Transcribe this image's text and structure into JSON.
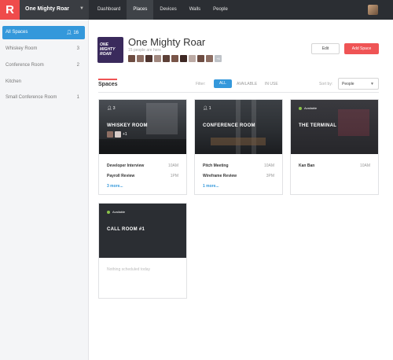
{
  "topbar": {
    "logo": "R",
    "org_name": "One Mighty Roar",
    "nav": [
      "Dashboard",
      "Places",
      "Devices",
      "Walls",
      "People"
    ],
    "active_nav": "Places"
  },
  "sidebar": {
    "items": [
      {
        "label": "All Spaces",
        "count": "16",
        "active": true
      },
      {
        "label": "Whiskey Room",
        "count": "3"
      },
      {
        "label": "Conference Room",
        "count": "2"
      },
      {
        "label": "Kitchen",
        "count": ""
      },
      {
        "label": "Small Conference Room",
        "count": "1"
      }
    ]
  },
  "place": {
    "logo_text": "ONE MIGHTY ROAR",
    "title": "One Mighty Roar",
    "subtitle": "15 people are here",
    "more_people": "+6",
    "edit_label": "Edit",
    "add_label": "Add Space"
  },
  "spaces": {
    "heading": "Spaces",
    "filter_label": "Filter:",
    "filters": [
      "ALL",
      "AVAILABLE",
      "IN USE"
    ],
    "sort_label": "Sort by:",
    "sort_value": "People"
  },
  "cards": [
    {
      "name": "WHISKEY ROOM",
      "occupancy": "3",
      "extra": "+1",
      "events": [
        {
          "title": "Developer Interview",
          "time": "10AM"
        },
        {
          "title": "Payroll Review",
          "time": "1PM"
        }
      ],
      "more": "3 more..."
    },
    {
      "name": "CONFERENCE ROOM",
      "occupancy": "1",
      "events": [
        {
          "title": "Pitch Meeting",
          "time": "10AM"
        },
        {
          "title": "Wireframe Review",
          "time": "3PM"
        }
      ],
      "more": "1 more..."
    },
    {
      "name": "THE TERMINAL",
      "status": "Available",
      "events": [
        {
          "title": "Kan Ban",
          "time": "10AM"
        }
      ]
    },
    {
      "name": "CALL ROOM #1",
      "status": "Available",
      "empty": "Nothing scheduled today"
    }
  ],
  "colors": {
    "accent": "#ef5455",
    "primary": "#3498db",
    "topbar": "#2b2e33",
    "available": "#8bc34a"
  }
}
